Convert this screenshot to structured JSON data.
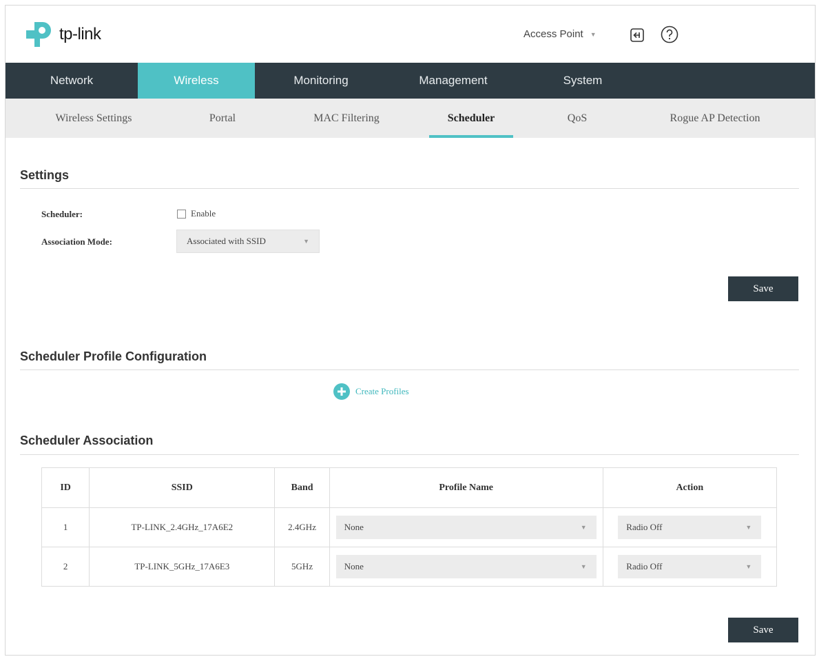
{
  "brand": {
    "name": "tp-link"
  },
  "header": {
    "mode": "Access Point",
    "icons": {
      "logout": "logout-icon",
      "help": "help-icon"
    }
  },
  "main_nav": {
    "items": [
      {
        "label": "Network"
      },
      {
        "label": "Wireless",
        "active": true
      },
      {
        "label": "Monitoring"
      },
      {
        "label": "Management"
      },
      {
        "label": "System"
      }
    ]
  },
  "sub_nav": {
    "items": [
      {
        "label": "Wireless Settings"
      },
      {
        "label": "Portal"
      },
      {
        "label": "MAC Filtering"
      },
      {
        "label": "Scheduler",
        "active": true
      },
      {
        "label": "QoS"
      },
      {
        "label": "Rogue AP Detection"
      }
    ]
  },
  "settings": {
    "title": "Settings",
    "scheduler_label": "Scheduler:",
    "enable_label": "Enable",
    "enable_checked": false,
    "association_mode_label": "Association Mode:",
    "association_mode_value": "Associated with SSID",
    "save_label": "Save"
  },
  "profile_config": {
    "title": "Scheduler Profile Configuration",
    "create_label": "Create Profiles"
  },
  "association": {
    "title": "Scheduler Association",
    "columns": [
      "ID",
      "SSID",
      "Band",
      "Profile Name",
      "Action"
    ],
    "rows": [
      {
        "id": "1",
        "ssid": "TP-LINK_2.4GHz_17A6E2",
        "band": "2.4GHz",
        "profile": "None",
        "action": "Radio Off"
      },
      {
        "id": "2",
        "ssid": "TP-LINK_5GHz_17A6E3",
        "band": "5GHz",
        "profile": "None",
        "action": "Radio Off"
      }
    ],
    "save_label": "Save"
  },
  "colors": {
    "nav_bg": "#2e3b43",
    "accent": "#4fc1c5",
    "subnav_bg": "#ececec",
    "button_bg": "#2e3b43"
  }
}
